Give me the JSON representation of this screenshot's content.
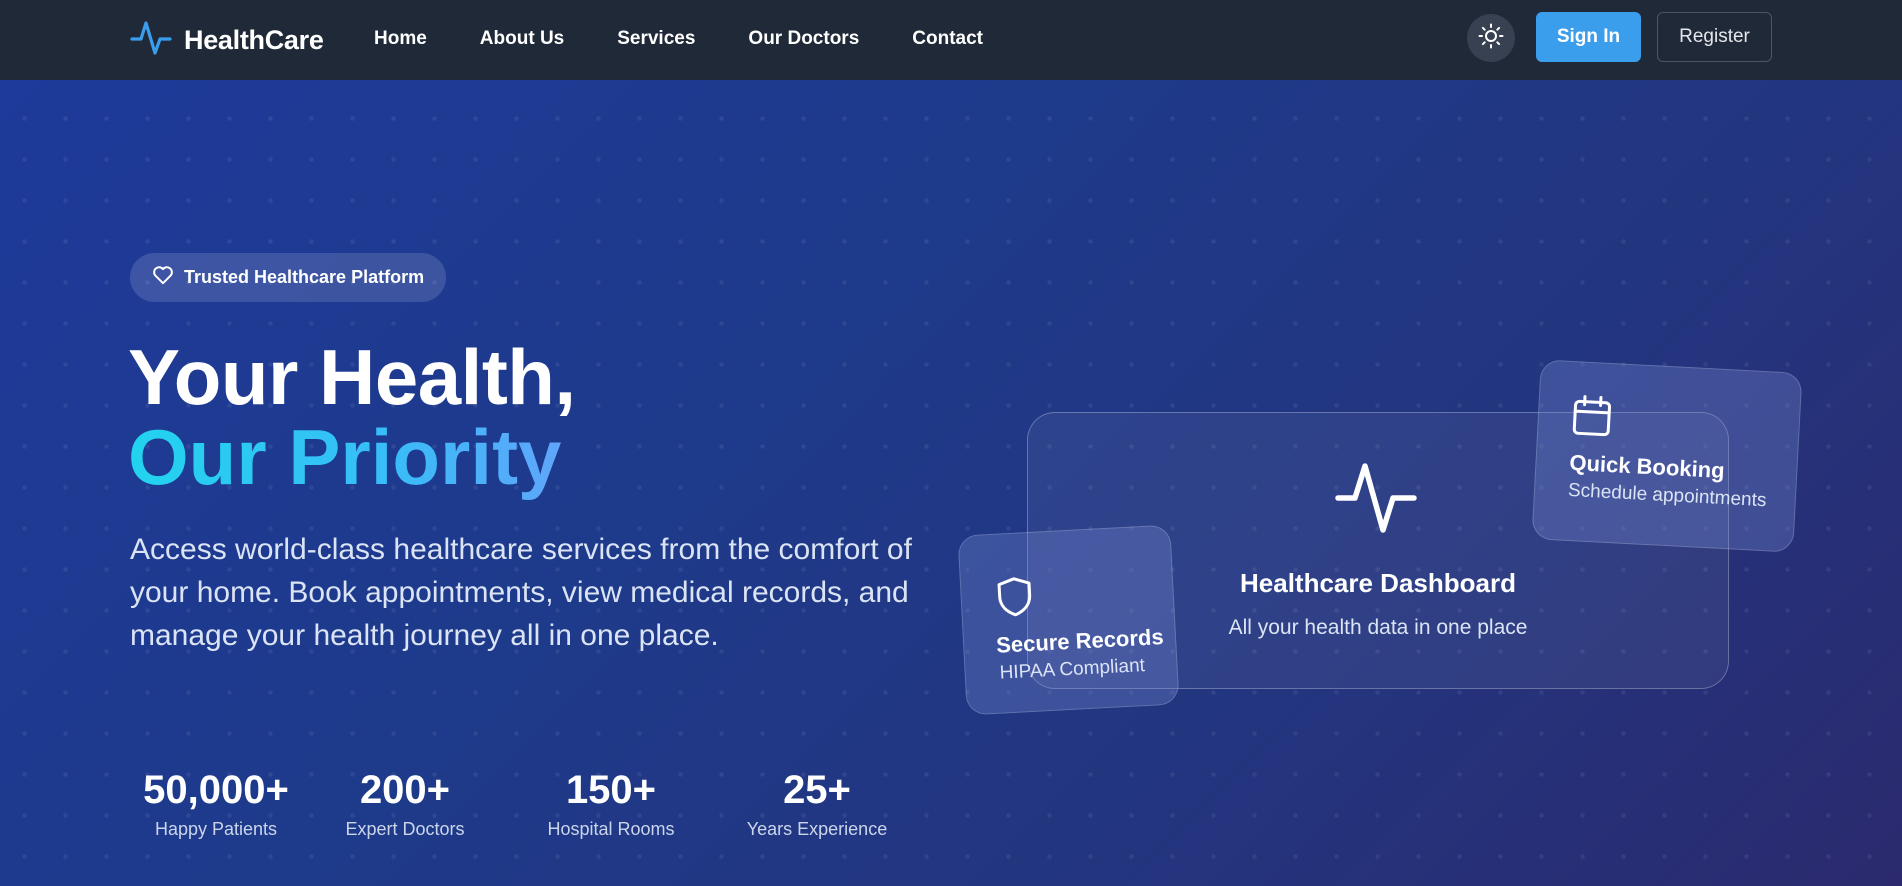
{
  "brand": {
    "name": "HealthCare",
    "logo_icon": "activity-icon",
    "accent": "#3b9eed"
  },
  "nav": {
    "links": [
      "Home",
      "About Us",
      "Services",
      "Our Doctors",
      "Contact"
    ],
    "theme_icon": "sun-icon",
    "signin_label": "Sign In",
    "register_label": "Register"
  },
  "hero": {
    "badge": {
      "icon": "heart-icon",
      "label": "Trusted Healthcare Platform"
    },
    "title_line1": "Your Health,",
    "title_line2": "Our Priority",
    "description": "Access world-class healthcare services from the comfort of your home. Book appointments, view medical records, and manage your health journey all in one place.",
    "stats": [
      {
        "value": "50,000+",
        "label": "Happy Patients"
      },
      {
        "value": "200+",
        "label": "Expert Doctors"
      },
      {
        "value": "150+",
        "label": "Hospital Rooms"
      },
      {
        "value": "25+",
        "label": "Years Experience"
      }
    ]
  },
  "dashboard": {
    "icon": "activity-icon",
    "title": "Healthcare Dashboard",
    "subtitle": "All your health data in one place"
  },
  "cards": {
    "booking": {
      "icon": "calendar-icon",
      "title": "Quick Booking",
      "subtitle": "Schedule appointments"
    },
    "secure": {
      "icon": "shield-icon",
      "title": "Secure Records",
      "subtitle": "HIPAA Compliant"
    }
  }
}
